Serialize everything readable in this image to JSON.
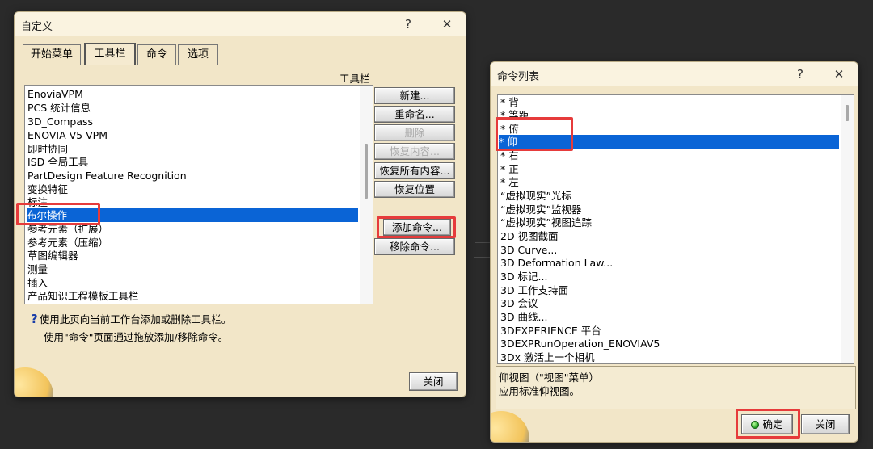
{
  "customize_dialog": {
    "title": "自定义",
    "help": "?",
    "close_x": "✕",
    "tabs": [
      "开始菜单",
      "工具栏",
      "命令",
      "选项"
    ],
    "toolbar_label": "工具栏",
    "toolbars": [
      "EnoviaVPM",
      "PCS 统计信息",
      "3D_Compass",
      "ENOVIA V5 VPM",
      "即时协同",
      "ISD 全局工具",
      "PartDesign Feature Recognition",
      "变换特征",
      "标注",
      "布尔操作",
      "参考元素（扩展）",
      "参考元素（压缩）",
      "草图编辑器",
      "测量",
      "插入",
      "产品知识工程模板工具栏"
    ],
    "selected_toolbar": "布尔操作",
    "buttons": {
      "new": "新建...",
      "rename": "重命名...",
      "delete": "删除",
      "restore_content": "恢复内容...",
      "restore_all": "恢复所有内容...",
      "restore_position": "恢复位置",
      "add_command": "添加命令...",
      "remove_command": "移除命令..."
    },
    "hint_line1": "使用此页向当前工作台添加或删除工具栏。",
    "hint_line2": "使用\"命令\"页面通过拖放添加/移除命令。",
    "close_button": "关闭"
  },
  "command_dialog": {
    "title": "命令列表",
    "help": "?",
    "close_x": "✕",
    "commands": [
      "* 背",
      "* 等距",
      "* 俯",
      "* 仰",
      "* 右",
      "* 正",
      "* 左",
      "“虚拟现实”光标",
      "“虚拟现实”监视器",
      "“虚拟现实”视图追踪",
      "2D 视图截面",
      "3D Curve...",
      "3D Deformation Law...",
      "3D 标记...",
      "3D 工作支持面",
      "3D 会议",
      "3D 曲线...",
      "3DEXPERIENCE 平台",
      "3DEXPRunOperation_ENOVIAV5",
      "3Dx 激活上一个相机"
    ],
    "selected_command": "* 仰",
    "description_line1": "仰视图（\"视图\"菜单）",
    "description_line2": "应用标准仰视图。",
    "ok_button": "确定",
    "close_button": "关闭"
  },
  "colors": {
    "dialog_bg": "#f2e6c8",
    "selection": "#0a64d6",
    "highlight_box": "#e63b3b"
  },
  "icons": [
    "help-icon",
    "close-icon",
    "led-icon",
    "catia-logo-icon"
  ]
}
